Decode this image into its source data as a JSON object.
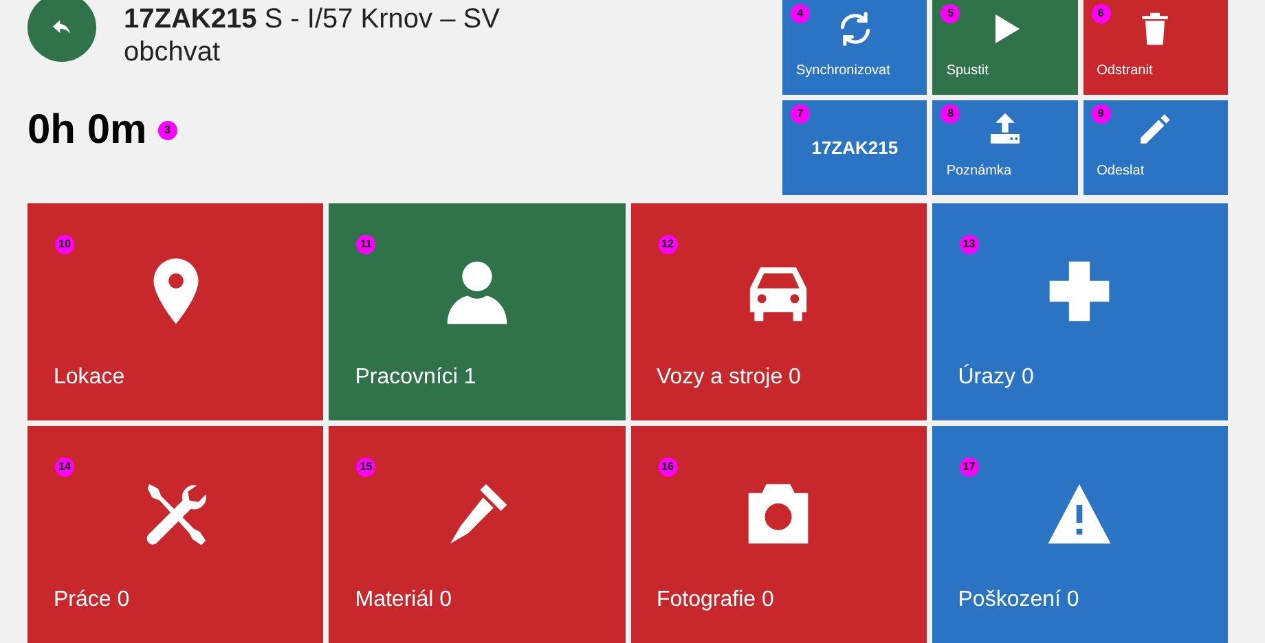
{
  "header": {
    "title_code": "17ZAK215",
    "title_rest": "S - I/57 Krnov – SV obchvat",
    "timer": "0h 0m",
    "timer_marker": "3"
  },
  "actions": [
    {
      "marker": "4",
      "kind": "sync",
      "label": "Synchronizovat",
      "color": "#2b74c3"
    },
    {
      "marker": "5",
      "kind": "play",
      "label": "Spustit",
      "color": "#30734b"
    },
    {
      "marker": "6",
      "kind": "trash",
      "label": "Odstranit",
      "color": "#c8272b"
    },
    {
      "marker": "7",
      "kind": "text",
      "label": "17ZAK215",
      "color": "#2b74c3"
    },
    {
      "marker": "8",
      "kind": "upload",
      "label": "Poznámka",
      "color": "#2b74c3"
    },
    {
      "marker": "9",
      "kind": "pencil",
      "label": "Odeslat",
      "color": "#2b74c3"
    }
  ],
  "tiles": [
    {
      "marker": "10",
      "kind": "pin",
      "label": "Lokace",
      "color": "#c8272b"
    },
    {
      "marker": "11",
      "kind": "person",
      "label": "Pracovníci 1",
      "color": "#30734b"
    },
    {
      "marker": "12",
      "kind": "car",
      "label": "Vozy a stroje 0",
      "color": "#c8272b"
    },
    {
      "marker": "13",
      "kind": "cross",
      "label": "Úrazy 0",
      "color": "#2b74c3"
    },
    {
      "marker": "14",
      "kind": "tools",
      "label": "Práce 0",
      "color": "#c8272b"
    },
    {
      "marker": "15",
      "kind": "screw",
      "label": "Materiál 0",
      "color": "#c8272b"
    },
    {
      "marker": "16",
      "kind": "camera",
      "label": "Fotografie 0",
      "color": "#c8272b"
    },
    {
      "marker": "17",
      "kind": "warning",
      "label": "Poškození 0",
      "color": "#2b74c3"
    }
  ]
}
